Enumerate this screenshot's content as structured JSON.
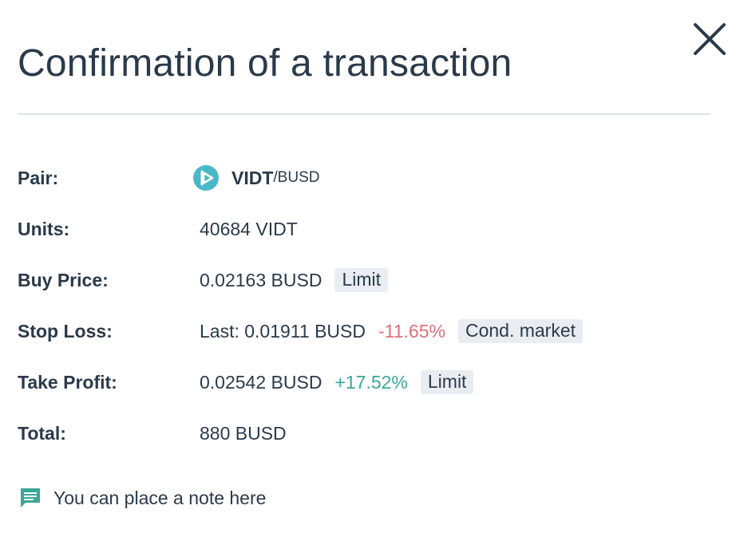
{
  "modal": {
    "title": "Confirmation of a transaction",
    "close_icon": "close-icon"
  },
  "details": {
    "pair": {
      "label": "Pair:",
      "icon": "vidt-coin-icon",
      "icon_color": "#4ab8c9",
      "base": "VIDT",
      "quote": "/BUSD"
    },
    "units": {
      "label": "Units:",
      "value": "40684 VIDT"
    },
    "buy_price": {
      "label": "Buy Price:",
      "value": "0.02163 BUSD",
      "tag": "Limit"
    },
    "stop_loss": {
      "label": "Stop Loss:",
      "value": "Last: 0.01911 BUSD",
      "change": "-11.65%",
      "change_color": "#e06d7b",
      "tag": "Cond. market"
    },
    "take_profit": {
      "label": "Take Profit:",
      "value": "0.02542 BUSD",
      "change": "+17.52%",
      "change_color": "#3aa79a",
      "tag": "Limit"
    },
    "total": {
      "label": "Total:",
      "value": "880 BUSD"
    }
  },
  "note": {
    "icon": "comment-icon",
    "icon_color": "#3aa79a",
    "text": "You can place a note here"
  }
}
